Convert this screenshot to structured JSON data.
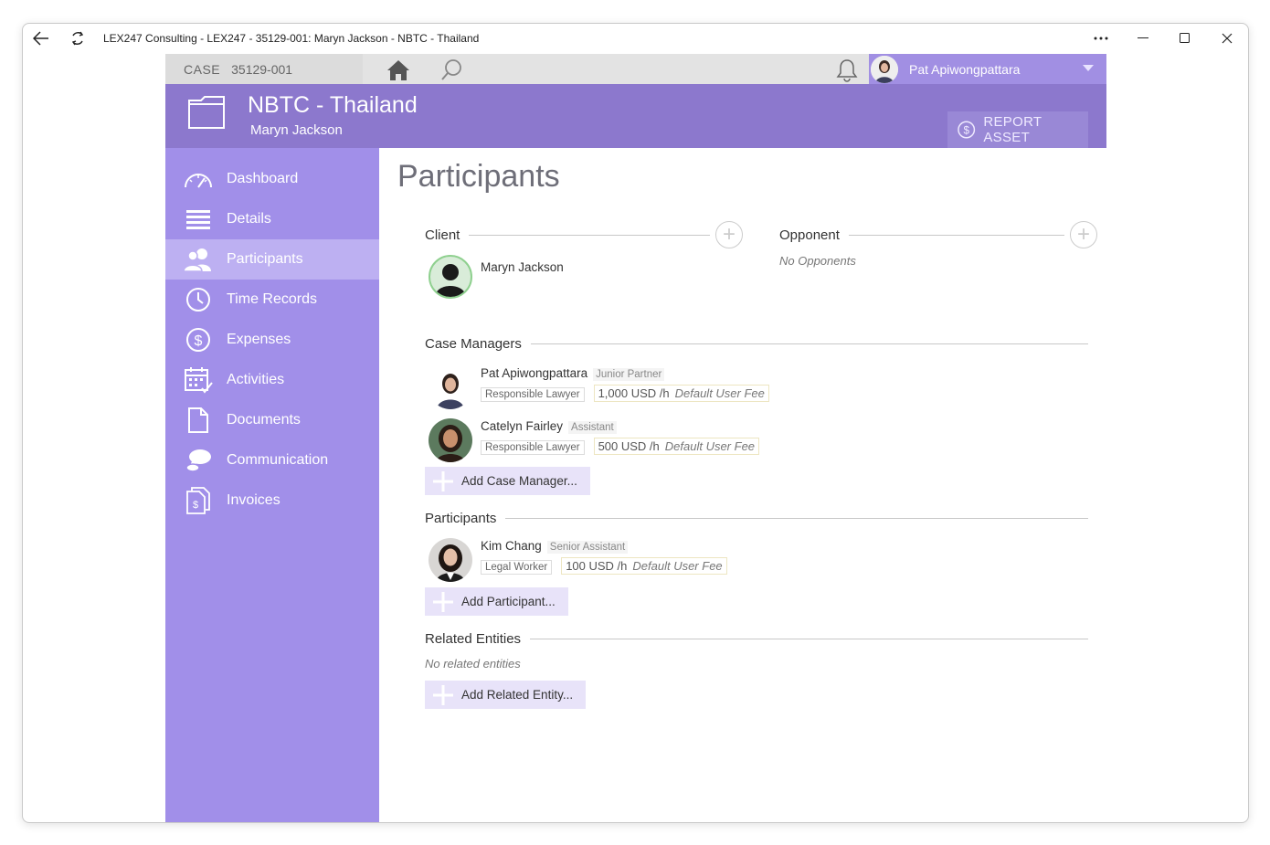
{
  "window": {
    "title": "LEX247 Consulting - LEX247 - 35129-001: Maryn Jackson - NBTC - Thailand"
  },
  "topbar": {
    "case_label": "CASE",
    "case_number": "35129-001",
    "user_name": "Pat Apiwongpattara"
  },
  "header": {
    "title": "NBTC - Thailand",
    "subtitle": "Maryn Jackson",
    "report_button": "REPORT ASSET"
  },
  "sidebar": {
    "items": [
      {
        "label": "Dashboard",
        "icon": "gauge-icon"
      },
      {
        "label": "Details",
        "icon": "list-icon"
      },
      {
        "label": "Participants",
        "icon": "people-icon",
        "active": true
      },
      {
        "label": "Time Records",
        "icon": "clock-icon"
      },
      {
        "label": "Expenses",
        "icon": "dollar-icon"
      },
      {
        "label": "Activities",
        "icon": "calendar-icon"
      },
      {
        "label": "Documents",
        "icon": "document-icon"
      },
      {
        "label": "Communication",
        "icon": "chat-icon"
      },
      {
        "label": "Invoices",
        "icon": "invoice-icon"
      }
    ]
  },
  "main": {
    "page_title": "Participants",
    "client": {
      "heading": "Client",
      "name": "Maryn Jackson"
    },
    "opponent": {
      "heading": "Opponent",
      "empty": "No Opponents"
    },
    "case_managers": {
      "heading": "Case Managers",
      "people": [
        {
          "name": "Pat Apiwongpattara",
          "role": "Junior Partner",
          "tag": "Responsible Lawyer",
          "fee": "1,000 USD /h",
          "fee_note": "Default User Fee"
        },
        {
          "name": "Catelyn Fairley",
          "role": "Assistant",
          "tag": "Responsible Lawyer",
          "fee": "500 USD /h",
          "fee_note": "Default User Fee"
        }
      ],
      "add_label": "Add Case Manager..."
    },
    "participants": {
      "heading": "Participants",
      "people": [
        {
          "name": "Kim Chang",
          "role": "Senior Assistant",
          "tag": "Legal Worker",
          "fee": "100 USD /h",
          "fee_note": "Default User Fee"
        }
      ],
      "add_label": "Add Participant..."
    },
    "related": {
      "heading": "Related Entities",
      "empty": "No related entities",
      "add_label": "Add Related Entity..."
    }
  },
  "colors": {
    "sidebar": "#a18fe9",
    "sidebar_active": "#bdb0f2",
    "header": "#8c78cd",
    "add_button": "#e8e3f9"
  }
}
